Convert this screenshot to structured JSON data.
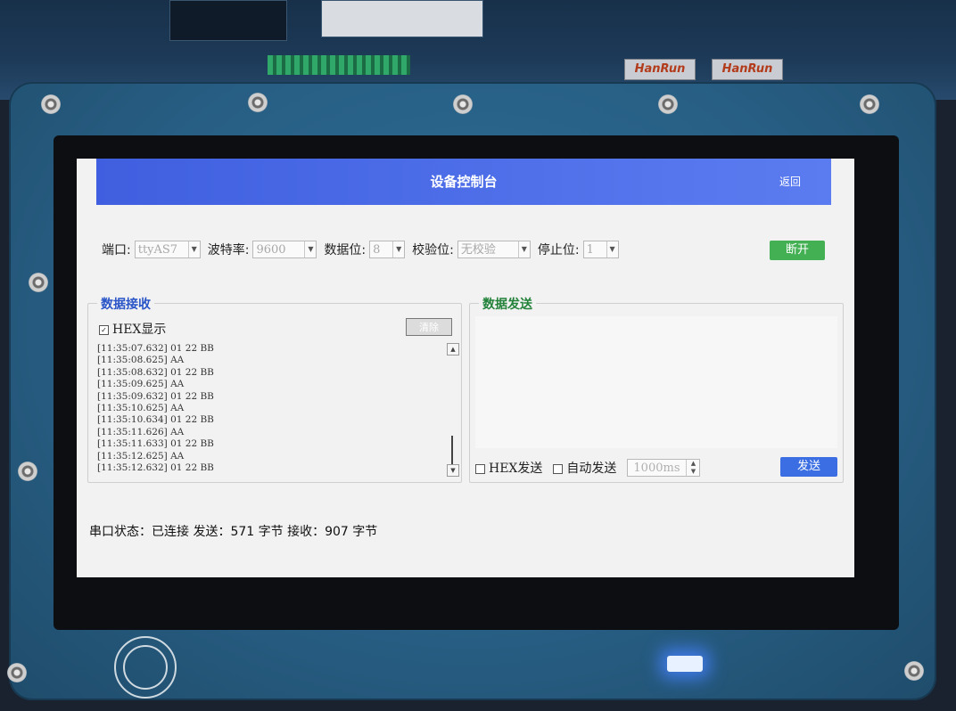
{
  "window": {
    "title": "设备控制台",
    "back_label": "返回"
  },
  "settings": {
    "port_label": "端口:",
    "port_value": "ttyAS7",
    "baud_label": "波特率:",
    "baud_value": "9600",
    "databits_label": "数据位:",
    "databits_value": "8",
    "parity_label": "校验位:",
    "parity_value": "无校验",
    "stopbits_label": "停止位:",
    "stopbits_value": "1",
    "disconnect_label": "断开"
  },
  "receive": {
    "title": "数据接收",
    "hex_display_label": "HEX显示",
    "hex_display_checked": true,
    "clear_label": "清除",
    "lines": [
      "[11:35:07.632] 01 22 BB",
      "[11:35:08.625] AA",
      "[11:35:08.632] 01 22 BB",
      "[11:35:09.625] AA",
      "[11:35:09.632] 01 22 BB",
      "[11:35:10.625] AA",
      "[11:35:10.634] 01 22 BB",
      "[11:35:11.626] AA",
      "[11:35:11.633] 01 22 BB",
      "[11:35:12.625] AA",
      "[11:35:12.632] 01 22 BB"
    ]
  },
  "send": {
    "title": "数据发送",
    "hex_send_label": "HEX发送",
    "auto_send_label": "自动发送",
    "interval_value": "1000ms",
    "send_label": "发送"
  },
  "status": {
    "text": "串口状态：已连接 发送：571 字节 接收：907 字节"
  },
  "board": {
    "jack_label_1": "HanRun",
    "jack_label_2": "HanRun"
  },
  "colors": {
    "title_bar": "#4a6be8",
    "disconnect": "#43b054",
    "send": "#3a6ee2",
    "frame": "#275d82"
  }
}
